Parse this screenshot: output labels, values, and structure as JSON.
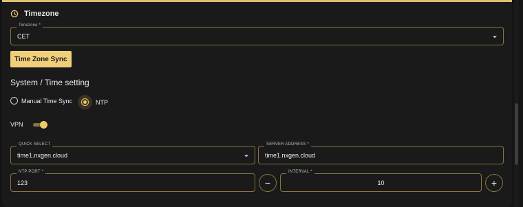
{
  "section": {
    "title": "Timezone",
    "icon": "clock-icon"
  },
  "timezone": {
    "label": "Timezone *",
    "value": "CET"
  },
  "sync_button": {
    "label": "Time Zone Sync"
  },
  "system_time": {
    "title": "System / Time setting",
    "options": [
      {
        "label": "Manual Time Sync",
        "checked": false
      },
      {
        "label": "NTP",
        "checked": true
      }
    ]
  },
  "vpn": {
    "label": "VPN",
    "enabled": true
  },
  "quick_select": {
    "label": "QUICK SELECT",
    "value": "time1.nxgen.cloud"
  },
  "server_address": {
    "label": "SERVER ADDRESS *",
    "value": "time1.nxgen.cloud"
  },
  "ntp_port": {
    "label": "NTP PORT *",
    "value": "123"
  },
  "interval": {
    "label": "INTERVAL *",
    "value": "10",
    "decrement": "−",
    "increment": "+"
  },
  "colors": {
    "accent": "#f0c96a",
    "border": "#8a7440",
    "background": "#1a1a1a"
  }
}
